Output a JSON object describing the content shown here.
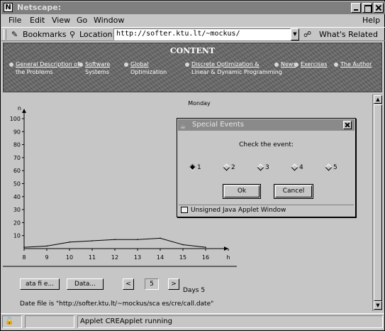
{
  "window": {
    "title": "Netscape:"
  },
  "menu": {
    "file": "File",
    "edit": "Edit",
    "view": "View",
    "go": "Go",
    "window": "Window",
    "help": "Help"
  },
  "toolbar": {
    "bookmarks_label": "Bookmarks",
    "location_label": "Location:",
    "location_value": "http://softer.ktu.lt/~mockus/",
    "whats_related": "What's Related"
  },
  "banner": {
    "title": "CONTENT",
    "links": [
      {
        "line1": "General Description of",
        "line2": "the Problems"
      },
      {
        "line1": "Software",
        "line2": "Systems"
      },
      {
        "line1": "Global",
        "line2": "Optimization"
      },
      {
        "line1": "Discrete Optimization &",
        "line2": "Linear & Dynamic Programming"
      },
      {
        "line1": "News",
        "line2": ""
      },
      {
        "line1": "Exercises",
        "line2": ""
      },
      {
        "line1": "The Author",
        "line2": ""
      }
    ]
  },
  "chart_data": {
    "type": "line",
    "title": "Monday",
    "ylabel": "n",
    "xlabel": "",
    "x": [
      8,
      9,
      10,
      11,
      12,
      13,
      14,
      15,
      16
    ],
    "values": [
      1,
      2,
      5,
      6,
      7,
      7,
      8,
      3,
      1
    ],
    "ylim": [
      0,
      100
    ],
    "xlim": [
      8,
      17
    ],
    "yticks": [
      10,
      20,
      30,
      40,
      50,
      60,
      70,
      80,
      90,
      100
    ],
    "xticks": [
      "8",
      "9",
      "10",
      "11",
      "12",
      "13",
      "14",
      "15",
      "16",
      "h"
    ]
  },
  "applet": {
    "data_file_button": "ata fi e...",
    "data_button": "Data...",
    "prev_button": "<",
    "day_value": "5",
    "next_button": ">",
    "days_label": "Days 5",
    "data_file_line": "Date file is \"http://softer.ktu.lt/~mockus/sca es/cre/call.date\""
  },
  "dialog": {
    "title": "Special Events",
    "prompt": "Check the event:",
    "options": [
      "1",
      "2",
      "3",
      "4",
      "5"
    ],
    "selected_option": "1",
    "ok": "Ok",
    "cancel": "Cancel",
    "warning": "Unsigned Java Applet Window"
  },
  "status": {
    "text": "Applet CREApplet running"
  }
}
